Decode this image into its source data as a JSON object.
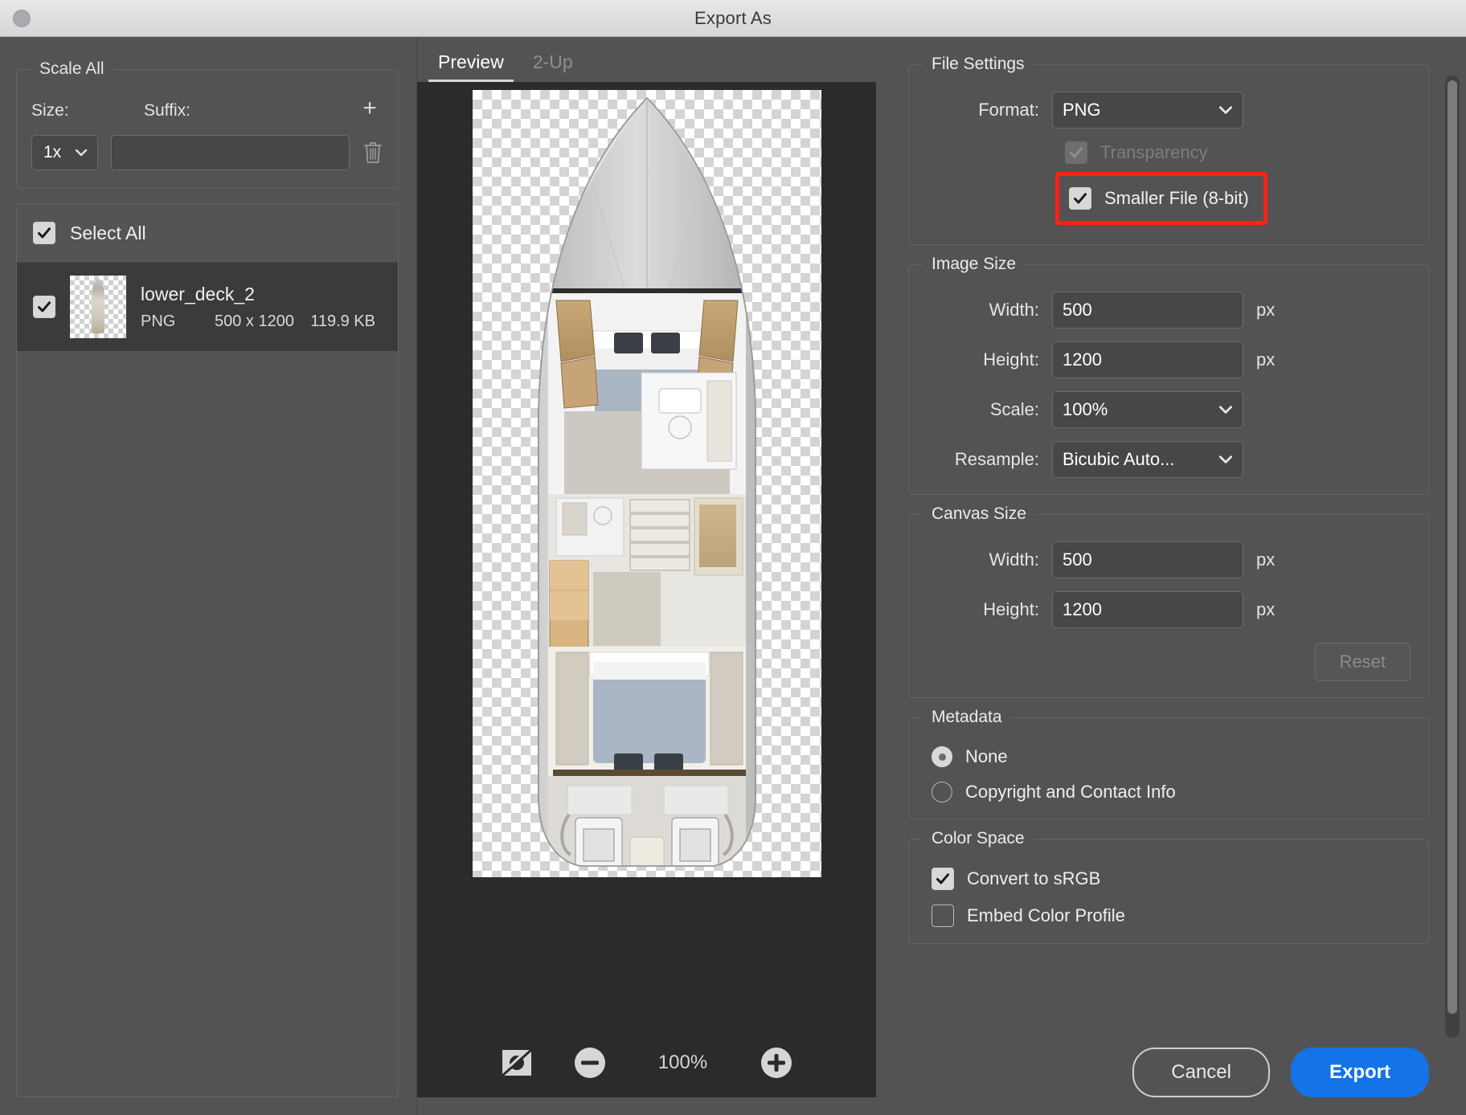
{
  "window": {
    "title": "Export As",
    "close_icon": "close-icon"
  },
  "left_panel": {
    "scale_all": {
      "legend": "Scale All",
      "size_label": "Size:",
      "suffix_label": "Suffix:",
      "add_icon": "plus-icon",
      "delete_icon": "trash-icon",
      "size_value": "1x",
      "suffix_value": "",
      "suffix_placeholder": ""
    },
    "file_list": {
      "select_all_label": "Select All",
      "select_all_checked": true,
      "items": [
        {
          "name": "lower_deck_2",
          "format": "PNG",
          "dimensions": "500 x 1200",
          "filesize": "119.9 KB",
          "checked": true,
          "selected": true
        }
      ]
    }
  },
  "preview": {
    "tabs": [
      {
        "label": "Preview",
        "active": true
      },
      {
        "label": "2-Up",
        "active": false
      }
    ],
    "toolbar": {
      "transparency_icon": "transparency-toggle-icon",
      "zoom_out_icon": "minus-circle-icon",
      "zoom_level": "100%",
      "zoom_in_icon": "plus-circle-icon"
    },
    "image_alt": "lower deck yacht floor plan"
  },
  "right_panel": {
    "file_settings": {
      "legend": "File Settings",
      "format_label": "Format:",
      "format_value": "PNG",
      "transparency_label": "Transparency",
      "transparency_checked": true,
      "transparency_disabled": true,
      "smaller_file_label": "Smaller File (8-bit)",
      "smaller_file_checked": true,
      "highlight_color": "#ff2016"
    },
    "image_size": {
      "legend": "Image Size",
      "width_label": "Width:",
      "width_value": "500",
      "height_label": "Height:",
      "height_value": "1200",
      "scale_label": "Scale:",
      "scale_value": "100%",
      "resample_label": "Resample:",
      "resample_value": "Bicubic Auto...",
      "unit": "px"
    },
    "canvas_size": {
      "legend": "Canvas Size",
      "width_label": "Width:",
      "width_value": "500",
      "height_label": "Height:",
      "height_value": "1200",
      "unit": "px",
      "reset_label": "Reset",
      "reset_disabled": true
    },
    "metadata": {
      "legend": "Metadata",
      "options": [
        {
          "label": "None",
          "selected": true
        },
        {
          "label": "Copyright and Contact Info",
          "selected": false
        }
      ]
    },
    "color_space": {
      "legend": "Color Space",
      "convert_label": "Convert to sRGB",
      "convert_checked": true,
      "embed_label": "Embed Color Profile",
      "embed_checked": false
    },
    "buttons": {
      "cancel_label": "Cancel",
      "export_label": "Export",
      "export_color": "#1473e6"
    }
  }
}
